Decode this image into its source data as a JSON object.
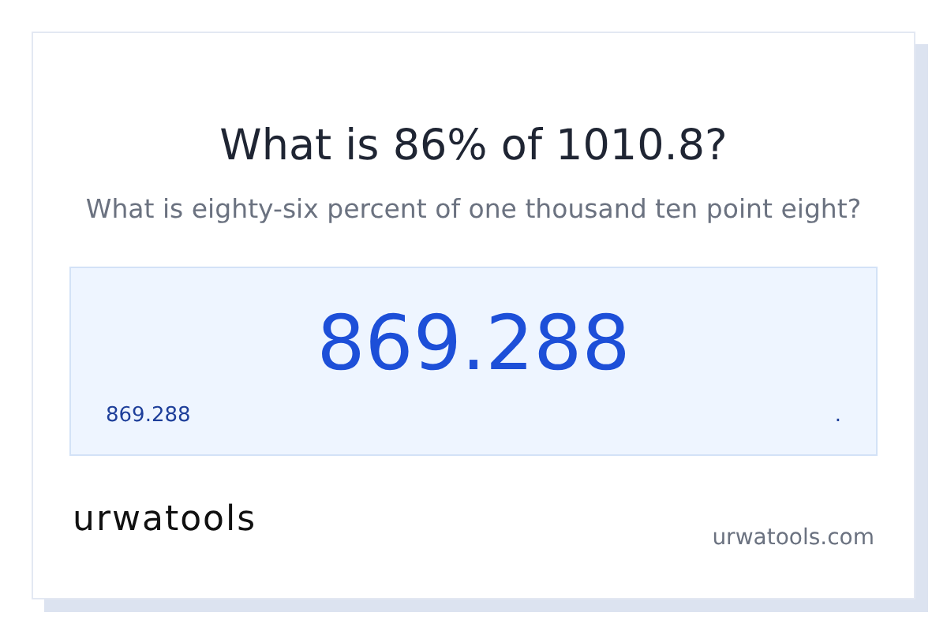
{
  "title": "What is 86% of 1010.8?",
  "subtitle": "What is eighty-six percent of one thousand ten point eight?",
  "result": {
    "value": "869.288",
    "small_value": "869.288",
    "trailing_mark": "."
  },
  "footer": {
    "logo": "urwatools",
    "site": "urwatools.com"
  }
}
